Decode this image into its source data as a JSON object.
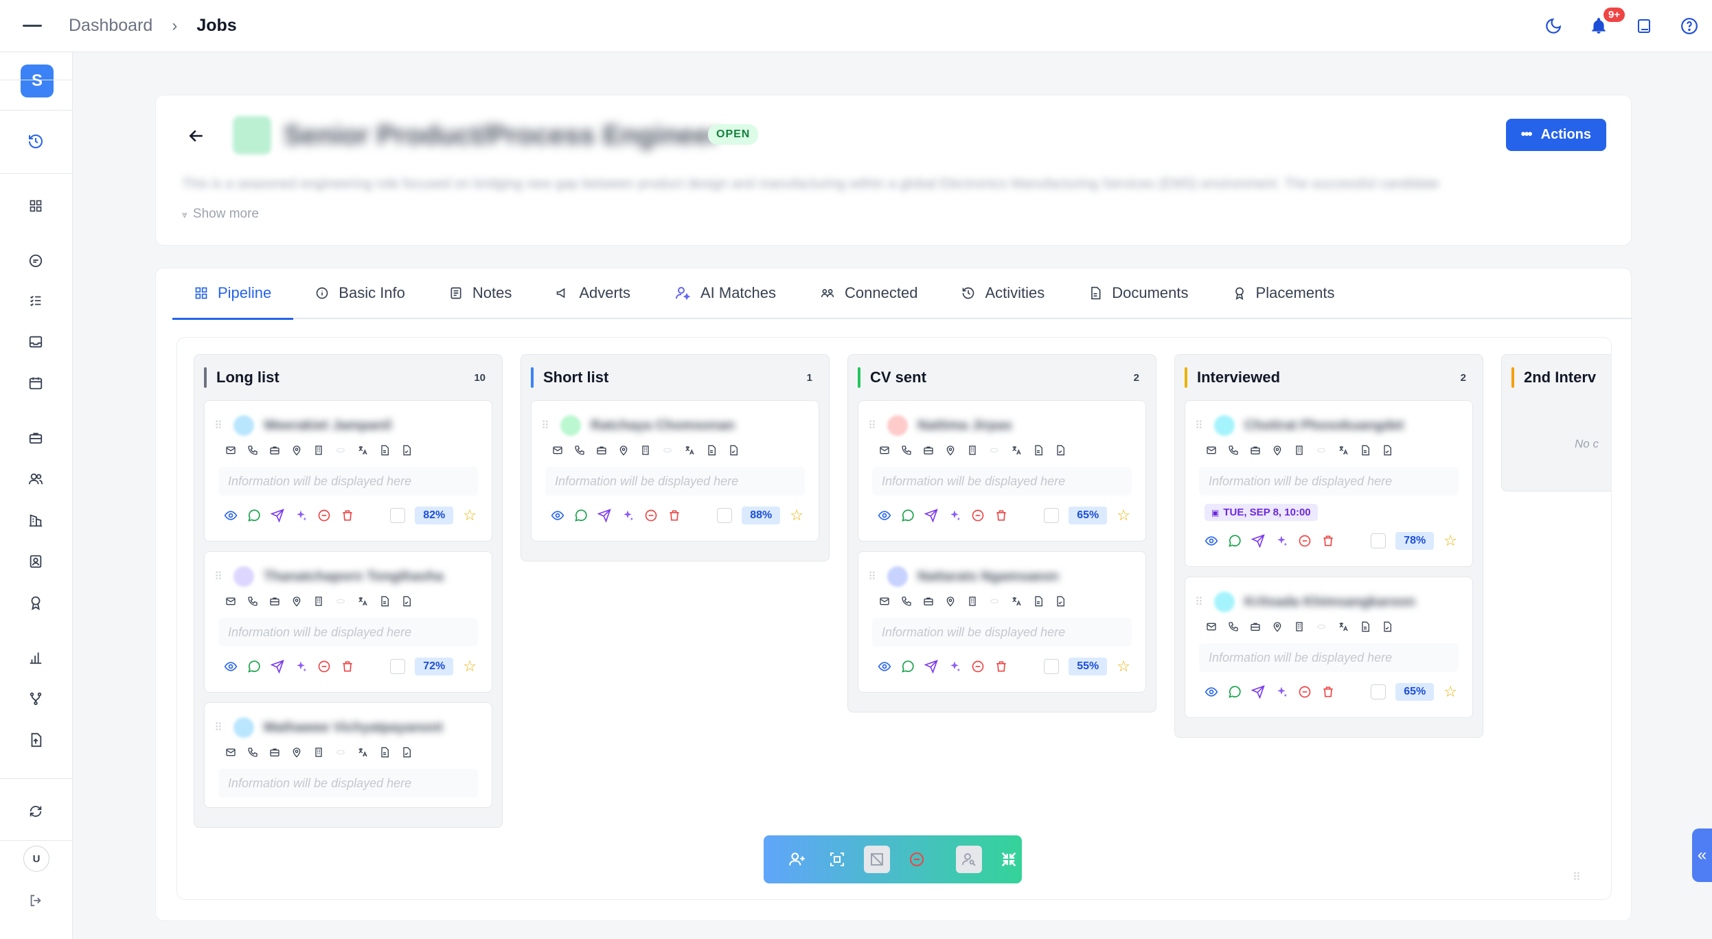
{
  "breadcrumb": {
    "parent": "Dashboard",
    "current": "Jobs"
  },
  "topbar": {
    "notifications_badge": "9+"
  },
  "sidebar": {
    "workspace_initial": "S",
    "user_initial": "U"
  },
  "job": {
    "title": "Senior Product/Process Engineer",
    "status": "OPEN",
    "description": "This is a seasoned engineering role focused on bridging new gap between product design and manufacturing within a global Electronics Manufacturing Services (EMS) environment. The successful candidate",
    "show_more": "Show more",
    "actions_label": "Actions"
  },
  "tabs": [
    {
      "label": "Pipeline",
      "icon": "kanban-icon"
    },
    {
      "label": "Basic Info",
      "icon": "info-icon"
    },
    {
      "label": "Notes",
      "icon": "note-icon"
    },
    {
      "label": "Adverts",
      "icon": "megaphone-icon"
    },
    {
      "label": "AI Matches",
      "icon": "ai-user-icon"
    },
    {
      "label": "Connected",
      "icon": "people-icon"
    },
    {
      "label": "Activities",
      "icon": "history-icon"
    },
    {
      "label": "Documents",
      "icon": "document-icon"
    },
    {
      "label": "Placements",
      "icon": "award-icon"
    }
  ],
  "info_placeholder": "Information will be displayed here",
  "columns": [
    {
      "title": "Long list",
      "count": "10",
      "color": "#6b7280",
      "cards": [
        {
          "name": "Weerakiet Jampanil",
          "avatar": "#bae6fd",
          "match": "82%"
        },
        {
          "name": "Thanatchaporn Tongthavha",
          "avatar": "#ddd6fe",
          "match": "72%"
        },
        {
          "name": "Mathawee Vichyatpayanont",
          "avatar": "#bae6fd",
          "match": ""
        }
      ]
    },
    {
      "title": "Short list",
      "count": "1",
      "color": "#3b82f6",
      "cards": [
        {
          "name": "Ratchaya Chomsonan",
          "avatar": "#bbf7d0",
          "match": "88%"
        }
      ]
    },
    {
      "title": "CV sent",
      "count": "2",
      "color": "#22c55e",
      "cards": [
        {
          "name": "Nattima Jirpas",
          "avatar": "#fecaca",
          "match": "65%"
        },
        {
          "name": "Nattarats Ngamsaeon",
          "avatar": "#c7d2fe",
          "match": "55%"
        }
      ]
    },
    {
      "title": "Interviewed",
      "count": "2",
      "color": "#eab308",
      "cards": [
        {
          "name": "Chotirat Phosokuangdet",
          "avatar": "#a5f3fc",
          "match": "78%",
          "date": "TUE, SEP 8, 10:00"
        },
        {
          "name": "Kritsada Khimsangkaroon",
          "avatar": "#a5f3fc",
          "match": "65%"
        }
      ]
    },
    {
      "title": "2nd Interv",
      "count": "",
      "color": "#f59e0b",
      "cards": [],
      "empty": "No c"
    }
  ],
  "colors": {
    "primary": "#2563eb",
    "open_green": "#15803d"
  }
}
